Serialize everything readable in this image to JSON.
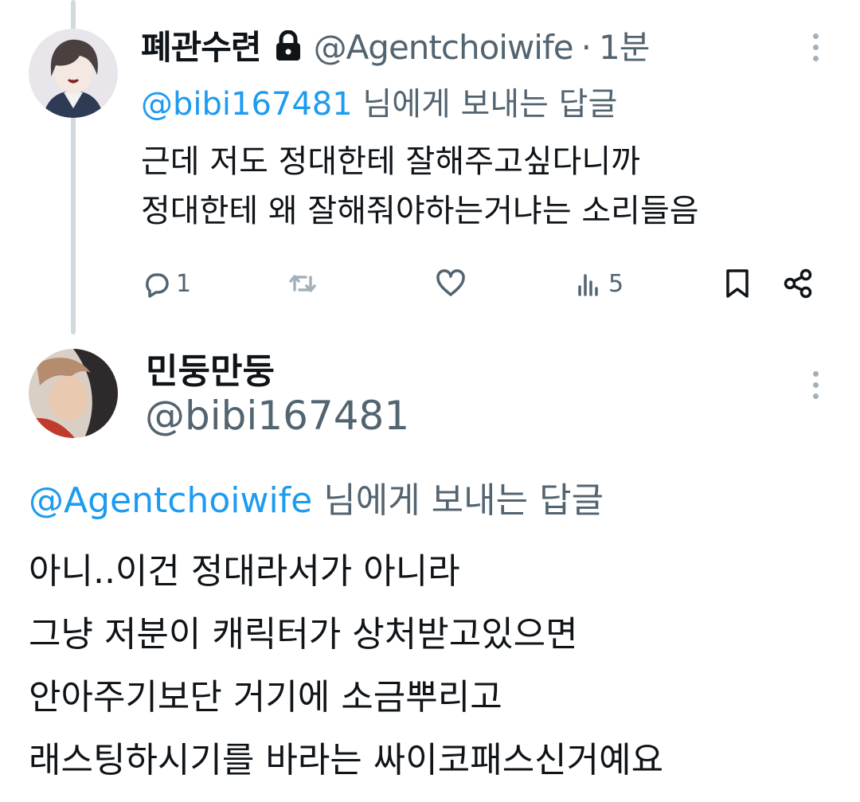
{
  "tweet1": {
    "display_name": "폐관수련",
    "handle": "@Agentchoiwife",
    "separator": "·",
    "time": "1분",
    "replying_to": "@bibi167481",
    "replying_suffix": "님에게 보내는 답글",
    "text_lines": [
      "근데 저도 정대한테 잘해주고싶다니까",
      "정대한테 왜 잘해줘야하는거냐는 소리들음"
    ],
    "actions": {
      "reply_count": "1",
      "retweet_count": "",
      "like_count": "",
      "views_count": "5"
    },
    "icons": {
      "lock": "lock-icon",
      "more": "more-vertical-icon",
      "reply": "reply-icon",
      "retweet": "retweet-icon",
      "like": "heart-icon",
      "views": "views-icon",
      "bookmark": "bookmark-icon",
      "share": "share-icon"
    }
  },
  "tweet2": {
    "display_name": "민둥만둥",
    "handle": "@bibi167481",
    "replying_to": "@Agentchoiwife",
    "replying_suffix": "님에게 보내는 답글",
    "text_lines": [
      "아니..이건 정대라서가 아니라",
      "그냥 저분이 캐릭터가 상처받고있으면",
      "안아주기보단 거기에 소금뿌리고",
      "래스팅하시기를 바라는 싸이코패스신거예요"
    ]
  },
  "colors": {
    "link": "#1d9bf0",
    "muted": "#536471",
    "text": "#0f1419",
    "thread_line": "#cfd9de"
  }
}
